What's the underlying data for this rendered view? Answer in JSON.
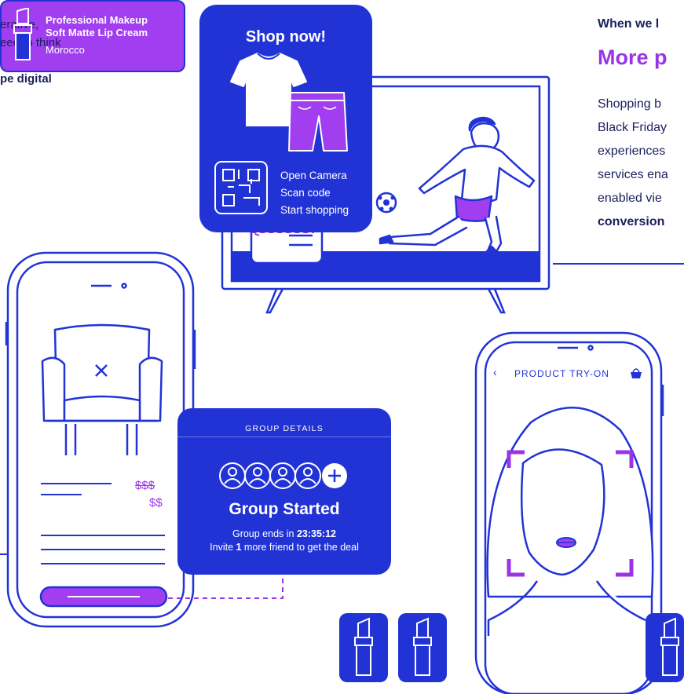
{
  "left_text": {
    "line1": "erative,",
    "line2": "eed to think",
    "line3": "pe digital"
  },
  "right_panel": {
    "kicker": "When we l",
    "heading": "More p",
    "body_lines": [
      "Shopping b",
      "Black Friday",
      "experiences",
      "services ena",
      "enabled vie"
    ],
    "body_bold_line": "conversion"
  },
  "shop_card": {
    "title": "Shop now!",
    "steps": [
      "Open Camera",
      "Scan code",
      "Start shopping"
    ],
    "icons": [
      "tshirt-icon",
      "shorts-icon",
      "qr-code-icon"
    ]
  },
  "armchair_phone": {
    "price_old": "$$$",
    "price_new": "$$"
  },
  "group_card": {
    "label": "GROUP DETAILS",
    "title": "Group Started",
    "ends_prefix": "Group ends in ",
    "ends_time": "23:35:12",
    "invite_prefix": "Invite ",
    "invite_count": "1",
    "invite_suffix": " more friend to get the deal"
  },
  "tryon_phone": {
    "back_icon": "‹",
    "title": "PRODUCT TRY-ON",
    "basket_icon": "basket-icon"
  },
  "lipstick_selected": {
    "product_line1": "Professional Makeup",
    "product_line2": "Soft Matte Lip Cream",
    "shade": "Morocco"
  },
  "colors": {
    "brand_blue": "#2233d6",
    "accent_purple": "#9b34e6",
    "text_navy": "#1b1f5e"
  }
}
